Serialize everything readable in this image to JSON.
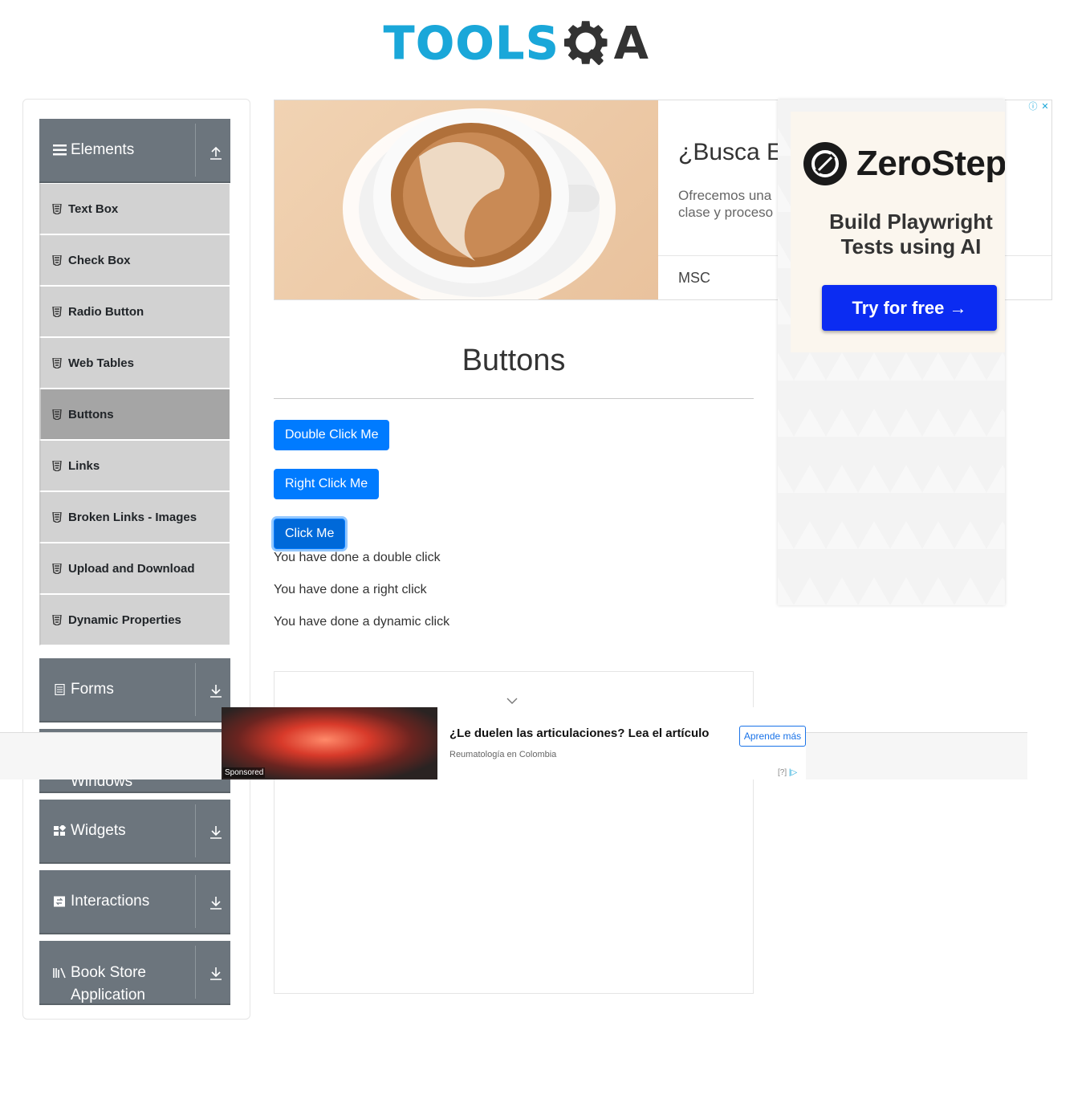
{
  "header": {
    "logo_text_left": "TOOLS",
    "logo_text_right": "A",
    "logo_name": "ToolsQA logo"
  },
  "sidebar": {
    "groups": [
      {
        "label": "Elements",
        "icon": "hamburger-icon",
        "arrow": "arrow-up-icon",
        "expanded": true
      },
      {
        "label": "Forms",
        "icon": "document-icon",
        "arrow": "arrow-down-icon",
        "expanded": false
      },
      {
        "label": "Windows",
        "icon": "window-icon",
        "arrow": "arrow-down-icon",
        "expanded": false
      },
      {
        "label": "Widgets",
        "icon": "widgets-icon",
        "arrow": "arrow-down-icon",
        "expanded": false
      },
      {
        "label": "Interactions",
        "icon": "interactions-icon",
        "arrow": "arrow-down-icon",
        "expanded": false
      },
      {
        "label": "Book Store",
        "label_line2": "Application",
        "icon": "books-icon",
        "arrow": "arrow-down-icon",
        "expanded": false
      }
    ],
    "items": [
      {
        "label": "Text Box"
      },
      {
        "label": "Check Box"
      },
      {
        "label": "Radio Button"
      },
      {
        "label": "Web Tables"
      },
      {
        "label": "Buttons",
        "active": true
      },
      {
        "label": "Links"
      },
      {
        "label": "Broken Links - Images"
      },
      {
        "label": "Upload and Download"
      },
      {
        "label": "Dynamic Properties"
      }
    ]
  },
  "top_ad": {
    "title": "¿Busca Ex",
    "text_line1": "Ofrecemos una",
    "text_line2": "clase y proceso",
    "brand": "MSC"
  },
  "zerostep_ad": {
    "brand": "ZeroStep",
    "tagline_line1": "Build Playwright",
    "tagline_line2": "Tests using AI",
    "cta": "Try for free →"
  },
  "main": {
    "title": "Buttons",
    "buttons": {
      "double_click": "Double Click Me",
      "right_click": "Right Click Me",
      "click": "Click Me"
    },
    "messages": {
      "double": "You have done a double click",
      "right": "You have done a right click",
      "dynamic": "You have done a dynamic click"
    }
  },
  "sticky_ad": {
    "title": "¿Le duelen las articulaciones? Lea el artículo",
    "subtitle": "Reumatología en Colombia",
    "cta": "Aprende más",
    "sponsored": "Sponsored",
    "adchoices": "[?]"
  },
  "colors": {
    "primary_button": "#007bff",
    "sidebar_header": "#6c757d",
    "menu_item_bg": "#d2d2d2",
    "menu_item_active": "#a5a5a5",
    "logo_blue": "#1aa7d9"
  }
}
